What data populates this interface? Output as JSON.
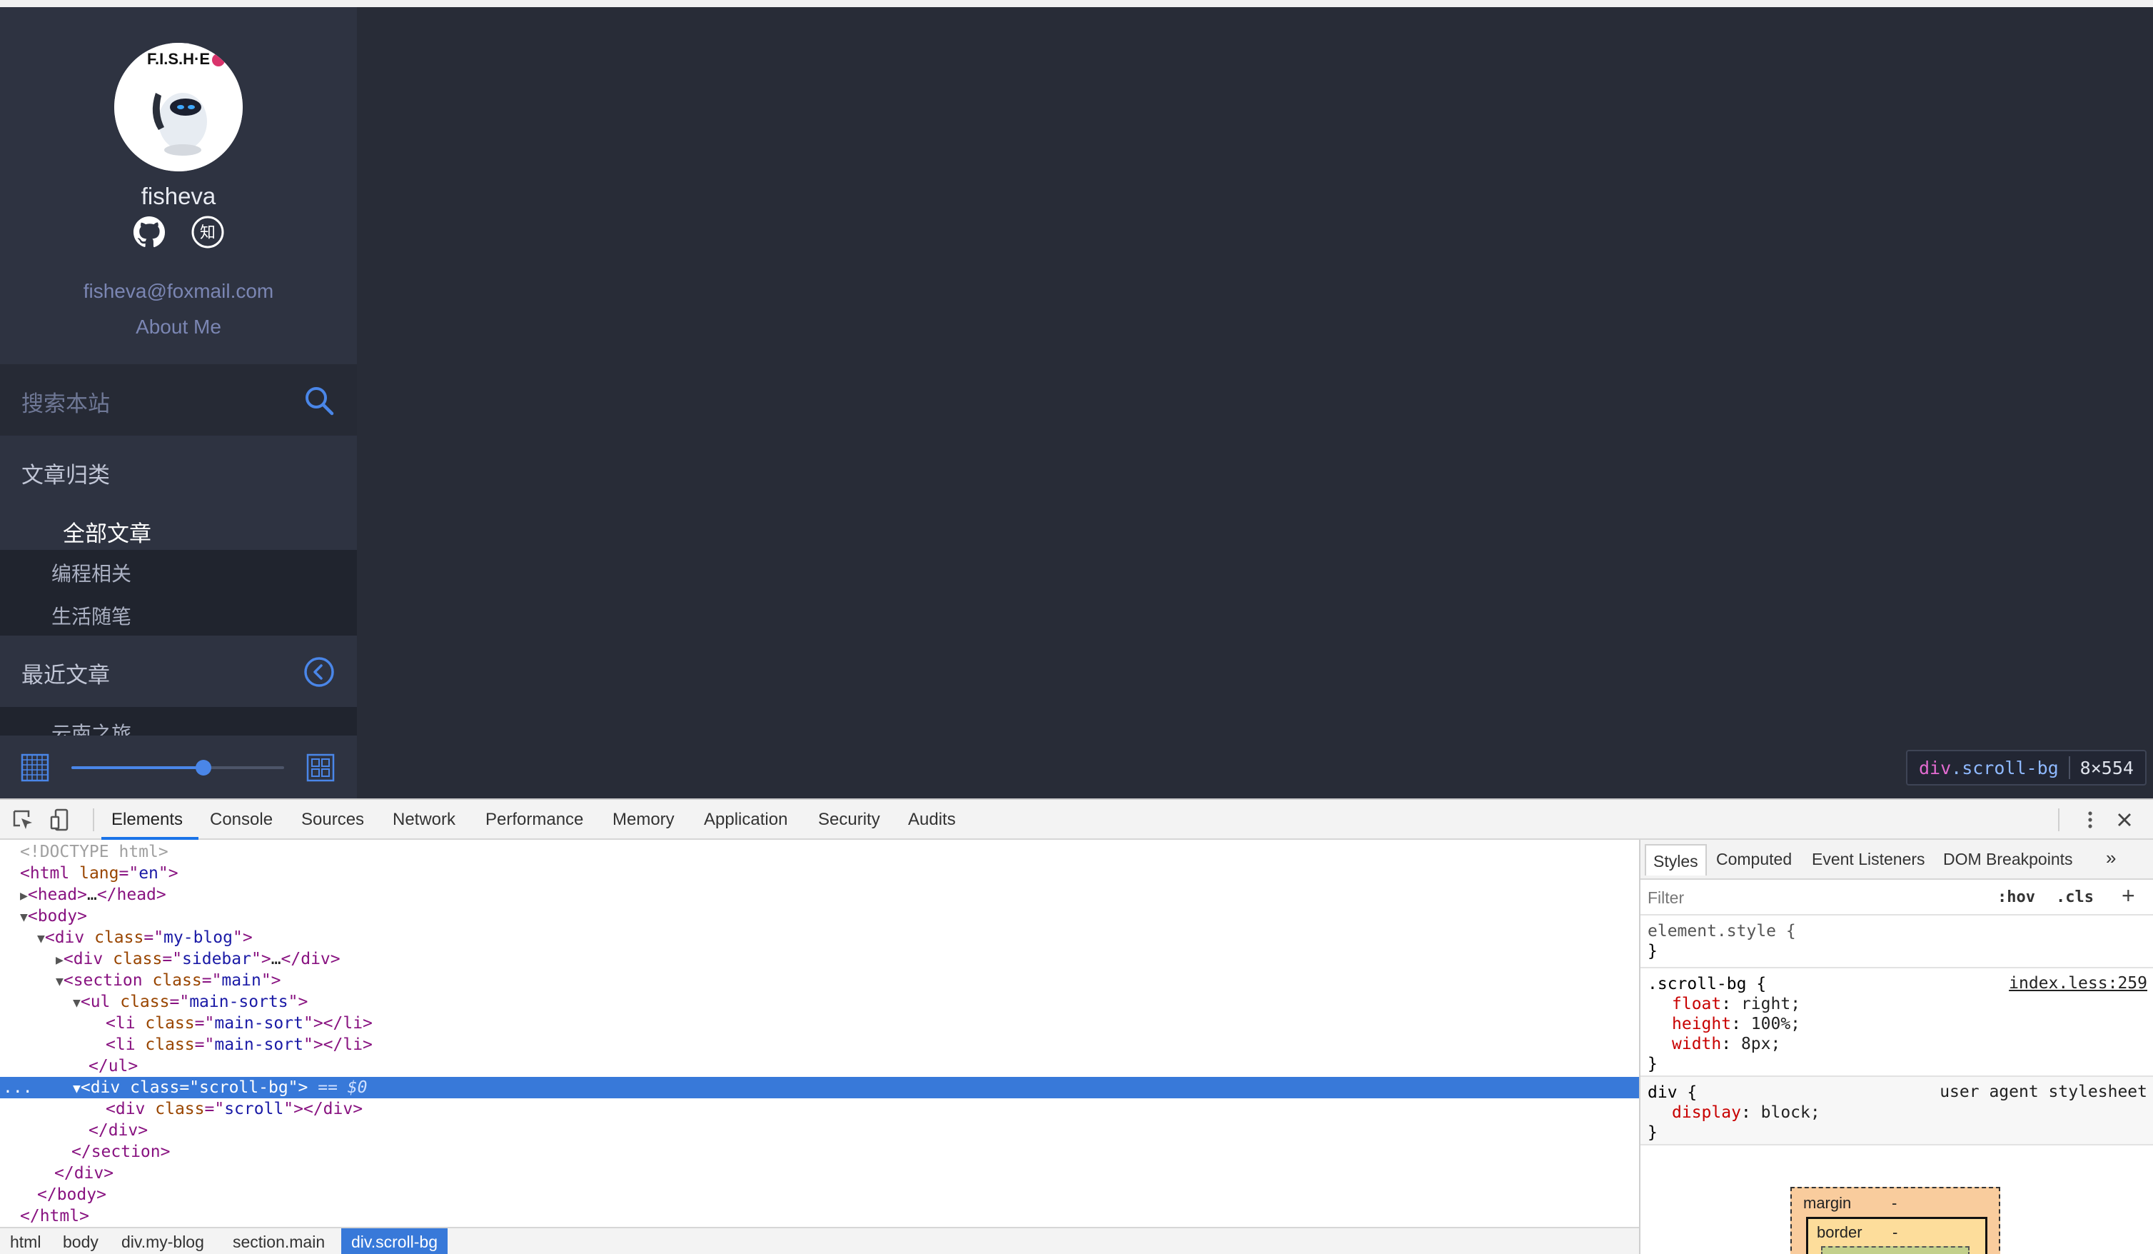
{
  "blog": {
    "username": "fisheva",
    "email": "fisheva@foxmail.com",
    "about": "About Me",
    "search_placeholder": "搜索本站",
    "categories_title": "文章归类",
    "category_all": "全部文章",
    "categories": [
      "编程相关",
      "生活随笔"
    ],
    "recent_title": "最近文章",
    "recent_partial": "云南之旅",
    "zoom_slider_fraction": 0.62
  },
  "avatar_text": "F.I.S.H·E",
  "tooltip": {
    "tag": "div",
    "cls": ".scroll-bg",
    "size": "8×554"
  },
  "devtools": {
    "tabs": [
      "Elements",
      "Console",
      "Sources",
      "Network",
      "Performance",
      "Memory",
      "Application",
      "Security",
      "Audits"
    ],
    "active_tab": "Elements",
    "breadcrumbs": [
      "html",
      "body",
      "div.my-blog",
      "section.main",
      "div.scroll-bg"
    ],
    "styles_tabs": [
      "Styles",
      "Computed",
      "Event Listeners",
      "DOM Breakpoints"
    ],
    "more_tabs": "»",
    "filter_placeholder": "Filter",
    "hov": ":hov",
    "cls_toggle": ".cls",
    "add_rule": "+",
    "element_style_open": "element.style {",
    "close_brace": "}",
    "rule1": {
      "selector": ".scroll-bg {",
      "source": "index.less:259",
      "props": [
        {
          "name": "float",
          "value": "right;"
        },
        {
          "name": "height",
          "value": "100%;"
        },
        {
          "name": "width",
          "value": "8px;"
        }
      ]
    },
    "rule2": {
      "selector": "div {",
      "source": "user agent stylesheet",
      "props": [
        {
          "name": "display",
          "value": "block;"
        }
      ]
    },
    "boxmodel": {
      "margin_label": "margin",
      "margin_val": "-",
      "border_label": "border",
      "border_val": "-"
    },
    "dom": {
      "doctype": "<!DOCTYPE html>",
      "html_lang": "en",
      "body": "body",
      "head": "head",
      "ellipsis": "…",
      "my_blog": "my-blog",
      "sidebar": "sidebar",
      "main": "main",
      "main_sorts": "main-sorts",
      "main_sort": "main-sort",
      "scroll_bg": "scroll-bg",
      "scroll": "scroll",
      "selected_suffix": " == $0",
      "dots": "..."
    }
  },
  "colors": {
    "page_bg": "#282c37",
    "sidebar_bg": "#2e3341",
    "accent_blue": "#4a86e8",
    "devtools_selection": "#3879d9"
  }
}
